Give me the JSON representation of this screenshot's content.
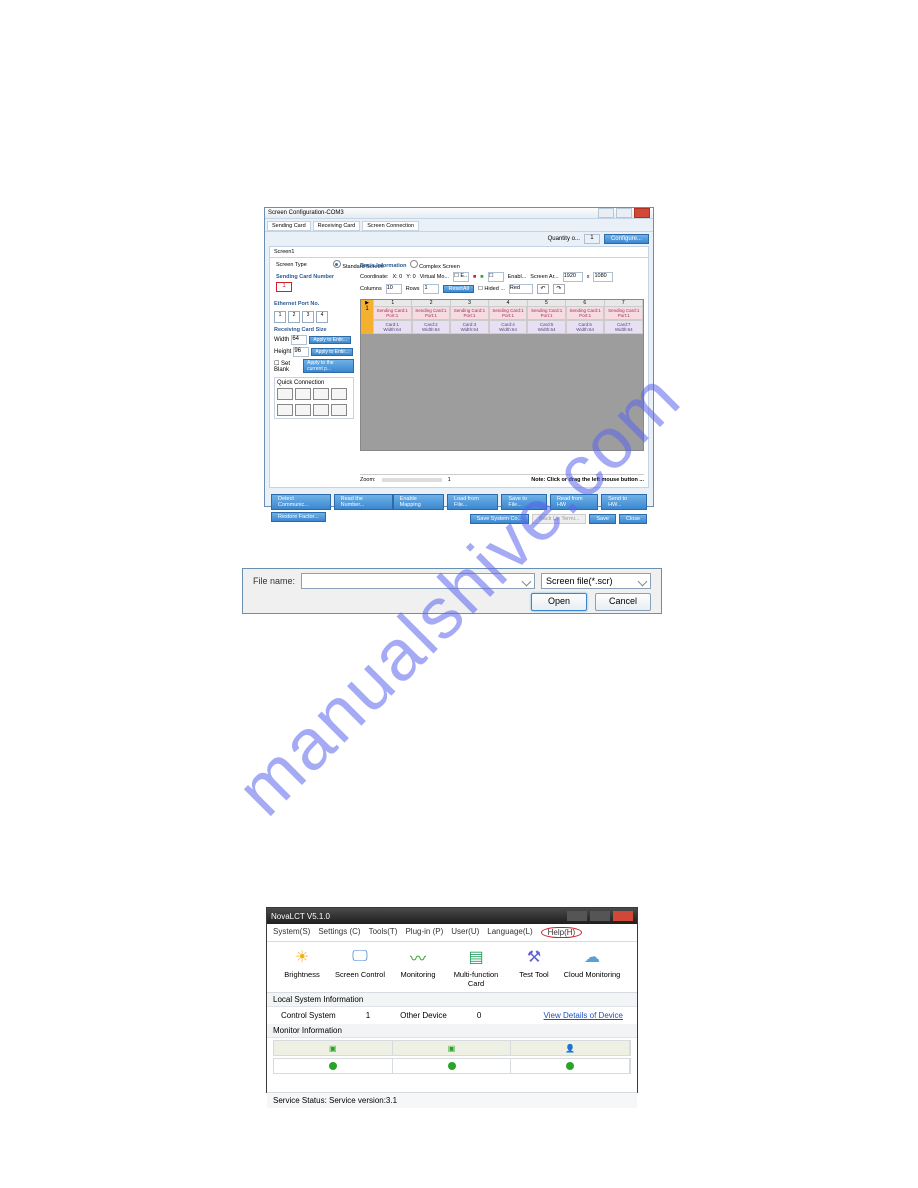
{
  "watermark": "manualshive.com",
  "win1": {
    "title": "Screen Configuration-COM3",
    "tabs": {
      "t1": "Sending Card",
      "t2": "Receiving Card",
      "t3": "Screen Connection"
    },
    "quantity_label": "Quantity o...",
    "quantity_value": "1",
    "configure": "Configure...",
    "subtab": "Screen1",
    "type_label": "Screen Type",
    "std_screen": "Standard Screen",
    "cplx_screen": "Complex Screen",
    "scn_label": "Sending Card Number",
    "scn_value": "1",
    "basic_info": "Basic Information",
    "coord_label": "Coordinate:",
    "coord_x": "X: 0",
    "coord_y": "Y: 0",
    "virtual": "Virtual Mo...",
    "enable": "Enabl...",
    "screen_ar": "Screen Ar...",
    "ar_w": "1920",
    "ar_h": "1080",
    "columns_label": "Columns",
    "columns_val": "10",
    "rows_label": "Rows",
    "rows_val": "1",
    "reset": "ResetAll",
    "hided": "Hided ...",
    "red": "Red",
    "back": "↶",
    "fwd": "↷",
    "port_label": "Ethernet Port No.",
    "port1": "1",
    "port2": "2",
    "port3": "3",
    "port4": "4",
    "rcs_label": "Receiving Card Size",
    "width_label": "Width",
    "width_val": "64",
    "height_label": "Height",
    "height_val": "96",
    "apply_port": "Apply to Entir...",
    "apply_port2": "Apply to Entir...",
    "setblank": "Set Blank",
    "apply_current": "Apply to the current p...",
    "qc_label": "Quick Connection",
    "card_top": "Sending Card:1",
    "card_port": "Port:1",
    "card_prefix": "Card:",
    "card_w": "Width:64",
    "zoom_label": "Zoom:",
    "zoom_val": "1",
    "note": "Note: Click or drag the left mouse button ...",
    "btn_detect": "Detect Communic...",
    "btn_readhw": "Read the Number...",
    "btn_enablemap": "Enable Mapping",
    "btn_loadfile": "Load from File...",
    "btn_savefile": "Save to File...",
    "btn_readhw2": "Read from HW",
    "btn_sendhw": "Send to HW...",
    "btn_restore": "Restore Factor...",
    "btn_savesys": "Save System Co...",
    "btn_backup": "Back Up Termi...",
    "btn_save": "Save",
    "btn_close": "Close"
  },
  "win2": {
    "filename_label": "File name:",
    "filter": "Screen file(*.scr)",
    "open": "Open",
    "cancel": "Cancel"
  },
  "win3": {
    "title": "NovaLCT V5.1.0",
    "menu": {
      "system": "System(S)",
      "settings": "Settings (C)",
      "tools": "Tools(T)",
      "plugin": "Plug-in (P)",
      "user": "User(U)",
      "language": "Language(L)",
      "help": "Help(H)"
    },
    "tools": {
      "brightness": "Brightness",
      "screen_control": "Screen Control",
      "monitoring": "Monitoring",
      "mfc": "Multi-function Card",
      "test_tool": "Test Tool",
      "cloud": "Cloud Monitoring"
    },
    "local_title": "Local System Information",
    "control_system": "Control System",
    "cs_val": "1",
    "other_device": "Other Device",
    "od_val": "0",
    "view_details": "View Details of Device",
    "monitor_title": "Monitor Information",
    "status": "Service Status:  Service version:3.1"
  }
}
